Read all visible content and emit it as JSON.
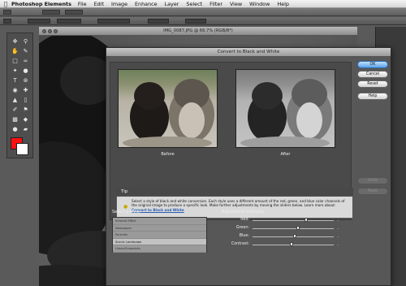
{
  "menubar": {
    "apple": "",
    "app_name": "Photoshop Elements",
    "items": [
      "File",
      "Edit",
      "Image",
      "Enhance",
      "Layer",
      "Select",
      "Filter",
      "View",
      "Window",
      "Help"
    ]
  },
  "document": {
    "title": "IMG_0087.JPG @ 66.7% (RGB/8*)"
  },
  "dialog": {
    "title": "Convert to Black and White",
    "before_label": "Before",
    "after_label": "After",
    "tip": {
      "title": "Tip",
      "text": "Select a style of black and white conversion. Each style uses a different amount of the red, green, and blue color channels of the original image to produce a specific look. Make further adjustments by moving the sliders below. Learn more about:",
      "link": "Convert to Black and White"
    },
    "style_section": {
      "title": "Select a style:",
      "items": [
        {
          "label": "Infrared Effect",
          "selected": false
        },
        {
          "label": "Newspaper",
          "selected": false
        },
        {
          "label": "Portraits",
          "selected": false
        },
        {
          "label": "Scenic Landscape",
          "selected": true
        },
        {
          "label": "Urban/Snapshots",
          "selected": false
        }
      ]
    },
    "adjustment": {
      "title": "Adjustment Intensity:",
      "sliders": [
        {
          "label": "Red:",
          "value": 0.66
        },
        {
          "label": "Green:",
          "value": 0.56
        },
        {
          "label": "Blue:",
          "value": 0.52
        },
        {
          "label": "Contrast:",
          "value": 0.48
        }
      ]
    },
    "buttons": {
      "ok": "OK",
      "cancel": "Cancel",
      "reset": "Reset",
      "help": "Help",
      "undo": "Undo",
      "redo": "Redo"
    }
  },
  "colors": {
    "foreground_swatch": "#ff1010",
    "background_swatch": "#ffffff",
    "primary_button": "#5aa2e6"
  }
}
